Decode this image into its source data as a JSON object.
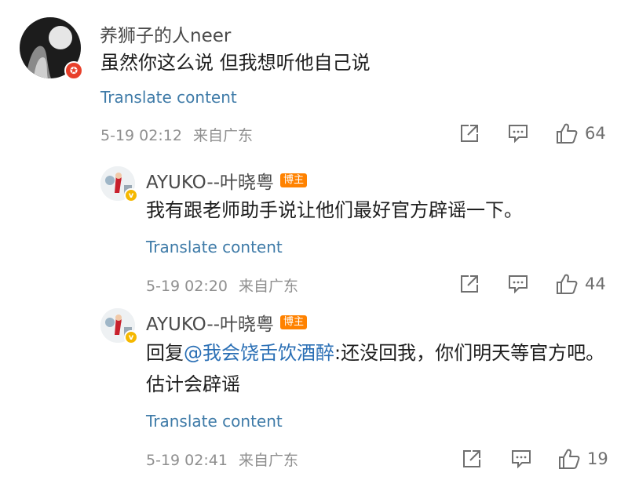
{
  "comments": [
    {
      "username": "养狮子的人neer",
      "text": "虽然你这么说 但我想听他自己说",
      "translate_label": "Translate content",
      "date": "5-19 02:12",
      "location": "来自广东",
      "likes": "64",
      "avatar_badge": "red-badge",
      "host_tag": ""
    }
  ],
  "replies": [
    {
      "username": "AYUKO--叶晓粤",
      "host_tag": "博主",
      "text": "我有跟老师助手说让他们最好官方辟谣一下。",
      "translate_label": "Translate content",
      "date": "5-19 02:20",
      "location": "来自广东",
      "likes": "44"
    },
    {
      "username": "AYUKO--叶晓粤",
      "host_tag": "博主",
      "reply_prefix": "回复",
      "mention": "@我会饶舌饮酒醉",
      "text": ":还没回我，你们明天等官方吧。估计会辟谣",
      "translate_label": "Translate content",
      "date": "5-19 02:41",
      "location": "来自广东",
      "likes": "19"
    }
  ],
  "colors": {
    "link": "#3f7ba8",
    "mention": "#2a6fb5",
    "host_tag_bg": "#ff8200",
    "meta_text": "#8f8f8f",
    "verified_badge": "#f5b800",
    "user_badge": "#e8402b"
  }
}
